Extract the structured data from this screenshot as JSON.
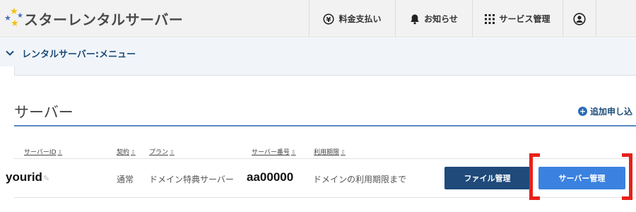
{
  "header": {
    "logo_text": "スターレンタルサーバー",
    "nav": {
      "fee_label": "料金支払い",
      "notice_label": "お知らせ",
      "service_label": "サービス管理"
    }
  },
  "menu": {
    "label": "レンタルサーバー:メニュー"
  },
  "section": {
    "title": "サーバー",
    "add_label": "追加申し込"
  },
  "table": {
    "headers": {
      "server_id": "サーバーID",
      "contract": "契約",
      "plan": "プラン",
      "server_number": "サーバー番号",
      "expiration": "利用期限"
    },
    "rows": [
      {
        "server_id": "yourid",
        "contract": "通常",
        "plan": "ドメイン特典サーバー",
        "server_number": "aa00000",
        "expiration": "ドメインの利用期限まで",
        "file_button": "ファイル管理",
        "server_button": "サーバー管理"
      }
    ]
  },
  "colors": {
    "primary_dark": "#1f4a7a",
    "primary_light": "#3b82e0",
    "highlight": "#e8211a",
    "menu_bg": "#f1f5fa"
  },
  "icons": {
    "logo": "stars-logo-icon",
    "fee": "yen-circle-icon",
    "notice": "bell-icon",
    "service": "grid-icon",
    "user": "user-circle-icon",
    "menu": "chevron-down-icon",
    "add": "plus-circle-icon",
    "edit": "pencil-icon"
  }
}
